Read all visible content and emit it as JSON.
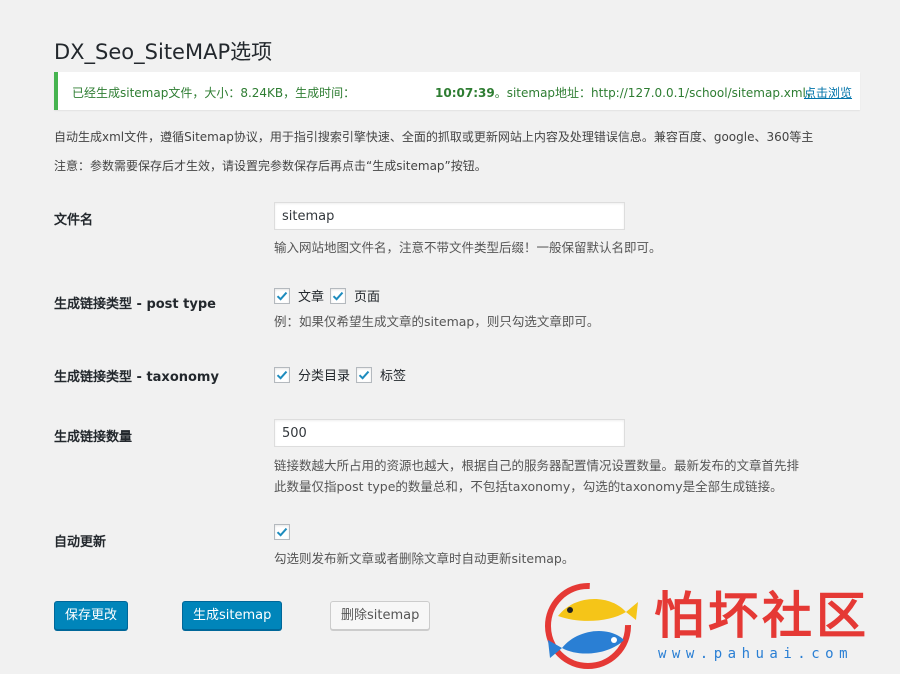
{
  "page": {
    "title": "DX_Seo_SiteMAP选项"
  },
  "notice": {
    "part1": "已经生成sitemap文件，大小：8.24KB，生成时间：",
    "time": "10:07:39",
    "part2": "。sitemap地址：",
    "url": "http://127.0.0.1/school/sitemap.xml",
    "sep": "，",
    "link": "点击浏览",
    "accent_color": "#46b450"
  },
  "intro": {
    "line1": "自动生成xml文件，遵循Sitemap协议，用于指引搜索引擎快速、全面的抓取或更新网站上内容及处理错误信息。兼容百度、google、360等主",
    "line2": "注意：参数需要保存后才生效，请设置完参数保存后再点击“生成sitemap”按钮。"
  },
  "fields": {
    "filename": {
      "label": "文件名",
      "value": "sitemap",
      "help": "输入网站地图文件名，注意不带文件类型后缀！一般保留默认名即可。"
    },
    "post_type": {
      "label": "生成链接类型 - post type",
      "options": [
        {
          "label": "文章",
          "checked": true
        },
        {
          "label": "页面",
          "checked": true
        }
      ],
      "help": "例：如果仅希望生成文章的sitemap，则只勾选文章即可。"
    },
    "taxonomy": {
      "label": "生成链接类型 - taxonomy",
      "options": [
        {
          "label": "分类目录",
          "checked": true
        },
        {
          "label": "标签",
          "checked": true
        }
      ]
    },
    "count": {
      "label": "生成链接数量",
      "value": "500",
      "help1": "链接数越大所占用的资源也越大，根据自己的服务器配置情况设置数量。最新发布的文章首先排",
      "help2": "此数量仅指post type的数量总和，不包括taxonomy，勾选的taxonomy是全部生成链接。"
    },
    "auto_update": {
      "label": "自动更新",
      "checked": true,
      "help": "勾选则发布新文章或者删除文章时自动更新sitemap。"
    }
  },
  "buttons": {
    "save": "保存更改",
    "generate": "生成sitemap",
    "delete": "删除sitemap"
  },
  "watermark": {
    "text": "怕坏社区",
    "url": "www.pahuai.com"
  }
}
